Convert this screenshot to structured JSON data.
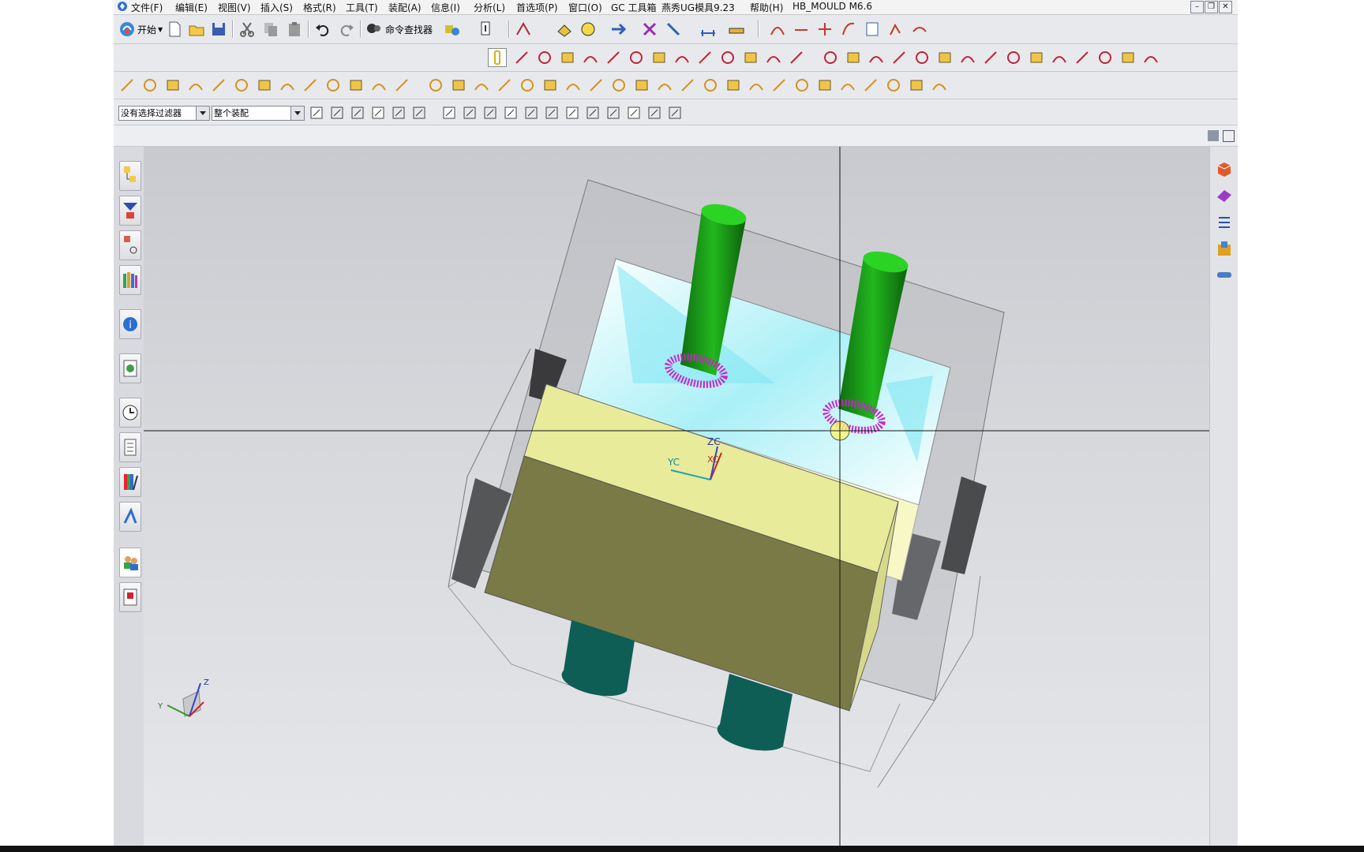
{
  "menu": {
    "items": [
      "文件(F)",
      "编辑(E)",
      "视图(V)",
      "插入(S)",
      "格式(R)",
      "工具(T)",
      "装配(A)",
      "信息(I)",
      "分析(L)",
      "首选项(P)",
      "窗口(O)",
      "GC 工具箱",
      "燕秀UG模具9.23",
      "帮助(H)",
      "HB_MOULD M6.6"
    ]
  },
  "toolbar": {
    "start_label": "开始",
    "command_finder_label": "命令查找器"
  },
  "selection_bar": {
    "filter_value": "没有选择过滤器",
    "scope_value": "整个装配"
  },
  "viewport": {
    "wcs_labels": {
      "zc": "ZC",
      "yc": "YC",
      "xc": "XC"
    },
    "triad_labels": {
      "z": "Z",
      "y": "Y"
    }
  },
  "colors": {
    "accent_green": "#16a214",
    "yellow_face": "#e8eb9a",
    "olive_face": "#7a7a46",
    "magenta_ring": "#cc22cc",
    "cyan_shade": "#7fe6f2"
  },
  "icons": {
    "left_rail": [
      "assembly-navigator-icon",
      "constraint-navigator-icon",
      "part-navigator-icon",
      "reuse-library-icon",
      "information-icon",
      "web-browser-icon",
      "history-icon",
      "system-materials-icon",
      "visualization-icon",
      "process-studio-icon",
      "roles-icon",
      "manufacturing-wizard-icon"
    ],
    "right_rail": [
      "mold-wizard-icon",
      "surface-icon",
      "layer-list-icon",
      "mold-base-icon",
      "pipe-icon"
    ]
  }
}
